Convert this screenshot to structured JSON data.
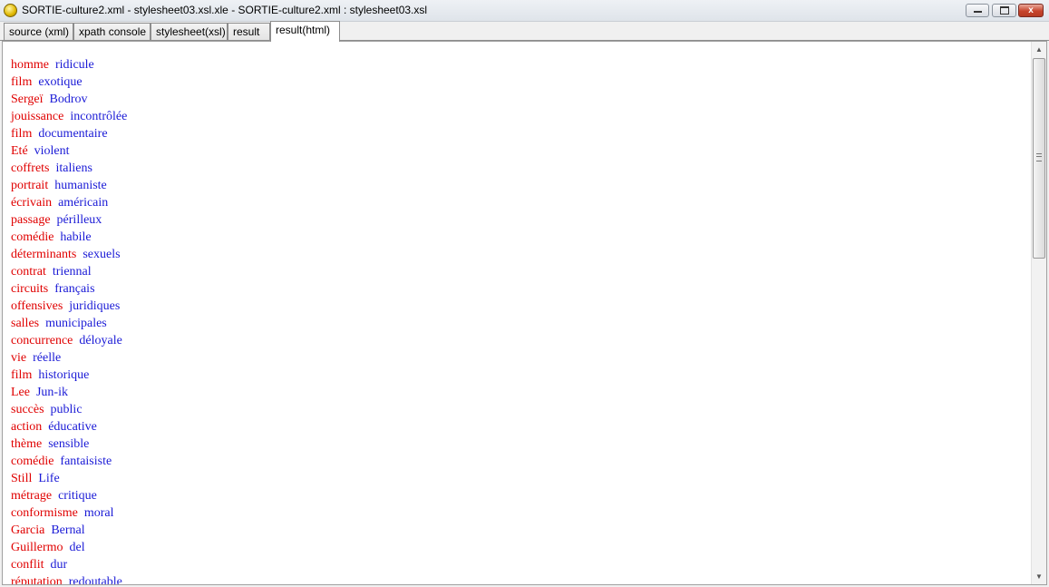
{
  "window": {
    "title": "SORTIE-culture2.xml - stylesheet03.xsl.xle - SORTIE-culture2.xml : stylesheet03.xsl",
    "icon": "app-icon",
    "controls": {
      "minimize": "minimize-icon",
      "maximize": "maximize-icon",
      "close": "x"
    }
  },
  "tabs": [
    {
      "label": "source (xml)"
    },
    {
      "label": "xpath console"
    },
    {
      "label": "stylesheet(xsl)"
    },
    {
      "label": "result"
    },
    {
      "label": "result(html)",
      "active": true
    }
  ],
  "colors": {
    "first_word": "#e00000",
    "second_word": "#1a1ad6"
  },
  "rows": [
    [
      "homme",
      "ridicule"
    ],
    [
      "film",
      "exotique"
    ],
    [
      "Sergeï",
      "Bodrov"
    ],
    [
      "jouissance",
      "incontrôlée"
    ],
    [
      "film",
      "documentaire"
    ],
    [
      "Eté",
      "violent"
    ],
    [
      "coffrets",
      "italiens"
    ],
    [
      "portrait",
      "humaniste"
    ],
    [
      "écrivain",
      "américain"
    ],
    [
      "passage",
      "périlleux"
    ],
    [
      "comédie",
      "habile"
    ],
    [
      "déterminants",
      "sexuels"
    ],
    [
      "contrat",
      "triennal"
    ],
    [
      "circuits",
      "français"
    ],
    [
      "offensives",
      "juridiques"
    ],
    [
      "salles",
      "municipales"
    ],
    [
      "concurrence",
      "déloyale"
    ],
    [
      "vie",
      "réelle"
    ],
    [
      "film",
      "historique"
    ],
    [
      "Lee",
      "Jun-ik"
    ],
    [
      "succès",
      "public"
    ],
    [
      "action",
      "éducative"
    ],
    [
      "thème",
      "sensible"
    ],
    [
      "comédie",
      "fantaisiste"
    ],
    [
      "Still",
      "Life"
    ],
    [
      "métrage",
      "critique"
    ],
    [
      "conformisme",
      "moral"
    ],
    [
      "Garcia",
      "Bernal"
    ],
    [
      "Guillermo",
      "del"
    ],
    [
      "conflit",
      "dur"
    ],
    [
      "réputation",
      "redoutable"
    ]
  ]
}
